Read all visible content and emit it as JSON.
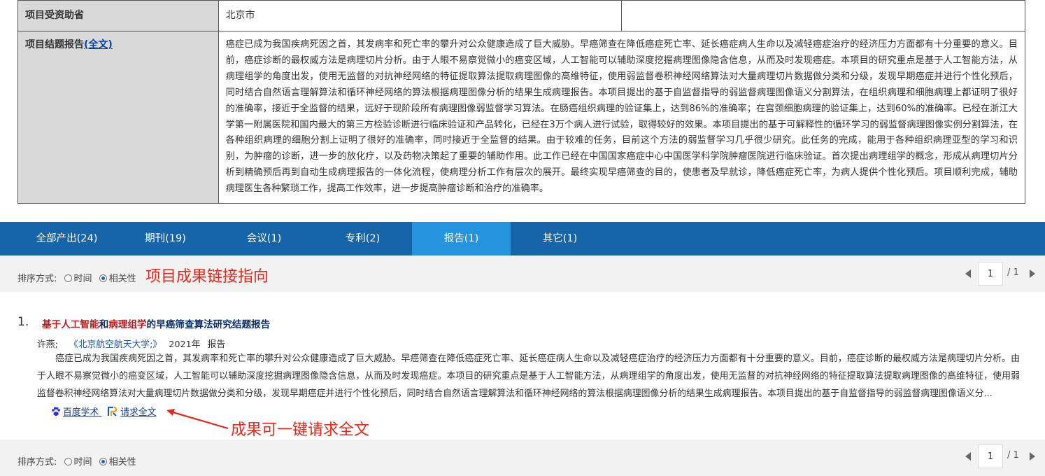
{
  "info": {
    "province_label": "项目受资助省",
    "province_value": "北京市",
    "report_label": "项目结题报告",
    "report_link": "(全文)",
    "report_text": "癌症已成为我国疾病死因之首，其发病率和死亡率的攀升对公众健康造成了巨大威胁。早癌筛查在降低癌症死亡率、延长癌症病人生命以及减轻癌症治疗的经济压力方面都有十分重要的意义。目前，癌症诊断的最权威方法是病理切片分析。由于人眼不易察觉微小的癌变区域，人工智能可以辅助深度挖掘病理图像隐含信息，从而及时发现癌症。本项目的研究重点是基于人工智能方法，从病理组学的角度出发，使用无监督的对抗神经网络的特征提取算法提取病理图像的高维特征，使用弱监督卷积神经网络算法对大量病理切片数据做分类和分级，发现早期癌症并进行个性化预后，同时结合自然语言理解算法和循环神经网络的算法根据病理图像分析的结果生成病理报告。本项目提出的基于自监督指导的弱监督病理图像语义分割算法，在组织病理和细胞病理上都证明了很好的准确率，接近于全监督的结果，远好于现阶段所有病理图像弱监督学习算法。在肠癌组织病理的验证集上，达到86%的准确率；在宫颈细胞病理的验证集上，达到60%的准确率。已经在浙江大学第一附属医院和国内最大的第三方检验诊断进行临床验证和产品转化，已经在3万个病人进行试验，取得较好的效果。本项目提出的基于可解释性的循环学习的弱监督病理图像实例分割算法，在各种组织病理的细胞分割上证明了很好的准确率，同时接近于全监督的结果。由于较难的任务，目前这个方法的弱监督学习几乎很少研究。此任务的完成，能用于各种组织病理亚型的学习和识别，为肿瘤的诊断，进一步的放化疗，以及药物决策起了重要的辅助作用。此工作已经在中国国家癌症中心中国医学科学院肿瘤医院进行临床验证。首次提出病理组学的概念，形成从病理切片分析到精确预后再到自动生成病理报告的一体化流程，使病理分析工作有层次的展开。最终实现早癌筛查的目的，使患者及早就诊，降低癌症死亡率，为病人提供个性化预后。项目顺利完成，辅助病理医生各种繁琐工作，提高工作效率，进一步提高肿瘤诊断和治疗的准确率。"
  },
  "tabs": [
    {
      "label": "全部产出(24)"
    },
    {
      "label": "期刊(19)"
    },
    {
      "label": "会议(1)"
    },
    {
      "label": "专利(2)"
    },
    {
      "label": "报告(1)"
    },
    {
      "label": "其它(1)"
    }
  ],
  "sort": {
    "label": "排序方式:",
    "opt_time": "时间",
    "opt_relevance": "相关性"
  },
  "pager": {
    "current": "1",
    "total": "/ 1"
  },
  "annotations": {
    "top": "项目成果链接指向",
    "bottom": "成果可一键请求全文"
  },
  "result": {
    "number": "1.",
    "title_parts": [
      "基于",
      "人工智能",
      "和",
      "病理组学",
      "的早癌筛查算法研究结题报告"
    ],
    "author": "许燕;",
    "source": "《北京航空航天大学;》",
    "year": "2021年",
    "type": "报告",
    "abstract": "癌症已成为我国疾病死因之首，其发病率和死亡率的攀升对公众健康造成了巨大威胁。早癌筛查在降低癌症死亡率、延长癌症病人生命以及减轻癌症治疗的经济压力方面都有十分重要的意义。目前，癌症诊断的最权威方法是病理切片分析。由于人眼不易察觉微小的癌变区域，人工智能可以辅助深度挖掘病理图像隐含信息，从而及时发现癌症。本项目的研究重点是基于人工智能方法，从病理组学的角度出发，使用无监督的对抗神经网络的特征提取算法提取病理图像的高维特征，使用弱监督卷积神经网络算法对大量病理切片数据做分类和分级，发现早期癌症并进行个性化预后，同时结合自然语言理解算法和循环神经网络的算法根据病理图像分析的结果生成病理报告。本项目提出的基于自监督指导的弱监督病理图像语义分...",
    "link_baidu": "百度学术",
    "link_request": "请求全文"
  },
  "colors": {
    "tab_bar": "#1565a8",
    "tab_active": "#2494de",
    "annotation": "#e8261b",
    "highlight": "#c01818",
    "title": "#0b2f6b"
  }
}
